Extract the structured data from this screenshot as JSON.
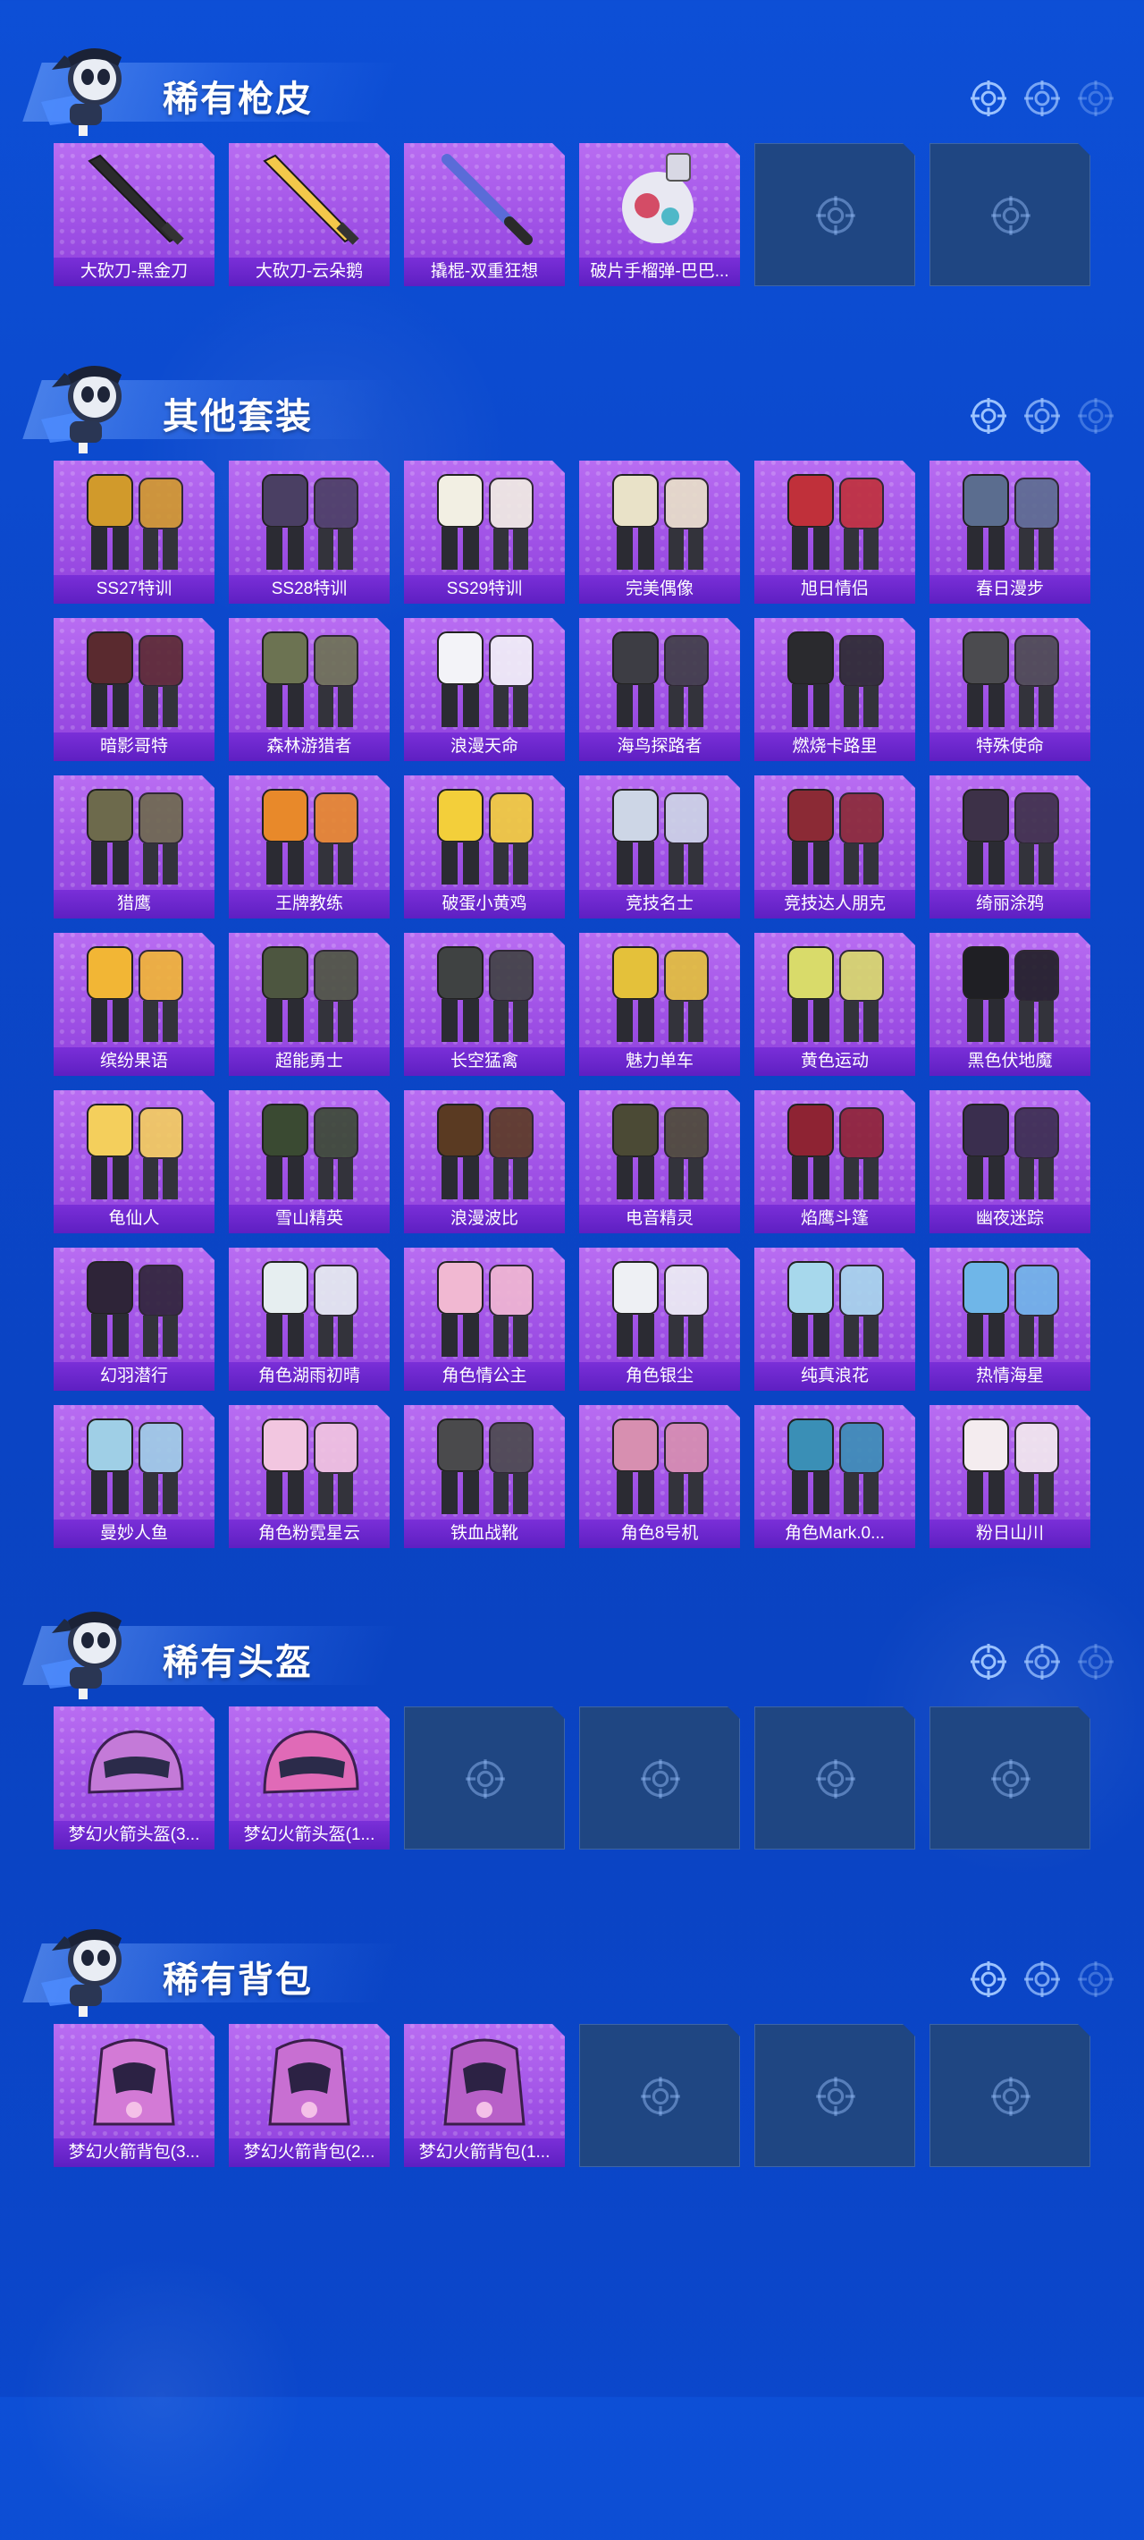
{
  "sections": [
    {
      "title": "稀有枪皮",
      "items": [
        {
          "label": "大砍刀-黑金刀",
          "icon": "blade-icon",
          "color": "#2b2b2b"
        },
        {
          "label": "大砍刀-云朵鹅",
          "icon": "blade-icon",
          "color": "#f3c84a"
        },
        {
          "label": "撬棍-双重狂想",
          "icon": "bat-icon",
          "color": "#5a6cd8"
        },
        {
          "label": "破片手榴弹-巴巴...",
          "icon": "grenade-icon",
          "color": "#e8e8f2"
        }
      ],
      "empty_slots": 2
    },
    {
      "title": "其他套装",
      "items": [
        {
          "label": "SS27特训",
          "icon": "outfit-icon",
          "color": "#d19a2b"
        },
        {
          "label": "SS28特训",
          "icon": "outfit-icon",
          "color": "#4a3f63"
        },
        {
          "label": "SS29特训",
          "icon": "outfit-icon",
          "color": "#f2efe3"
        },
        {
          "label": "完美偶像",
          "icon": "outfit-icon",
          "color": "#e9e2c8"
        },
        {
          "label": "旭日情侣",
          "icon": "outfit-icon",
          "color": "#c0303a"
        },
        {
          "label": "春日漫步",
          "icon": "outfit-icon",
          "color": "#5b6d8f"
        },
        {
          "label": "暗影哥特",
          "icon": "outfit-icon",
          "color": "#5a2a2f"
        },
        {
          "label": "森林游猎者",
          "icon": "outfit-icon",
          "color": "#6c7352"
        },
        {
          "label": "浪漫天命",
          "icon": "outfit-icon",
          "color": "#f3f3f8"
        },
        {
          "label": "海鸟探路者",
          "icon": "outfit-icon",
          "color": "#3d3d44"
        },
        {
          "label": "燃烧卡路里",
          "icon": "outfit-icon",
          "color": "#2a2a2e"
        },
        {
          "label": "特殊使命",
          "icon": "outfit-icon",
          "color": "#4b4b4f"
        },
        {
          "label": "猎鹰",
          "icon": "outfit-icon",
          "color": "#6d6a4c"
        },
        {
          "label": "王牌教练",
          "icon": "outfit-icon",
          "color": "#e8892a"
        },
        {
          "label": "破蛋小黄鸡",
          "icon": "outfit-icon",
          "color": "#f3cf3a"
        },
        {
          "label": "竞技名士",
          "icon": "outfit-icon",
          "color": "#cdd6e6"
        },
        {
          "label": "竞技达人朋克",
          "icon": "outfit-icon",
          "color": "#8b2a35"
        },
        {
          "label": "绮丽涂鸦",
          "icon": "outfit-icon",
          "color": "#3d3148"
        },
        {
          "label": "缤纷果语",
          "icon": "outfit-icon",
          "color": "#f2b635"
        },
        {
          "label": "超能勇士",
          "icon": "outfit-icon",
          "color": "#4d5640"
        },
        {
          "label": "长空猛禽",
          "icon": "outfit-icon",
          "color": "#3f4242"
        },
        {
          "label": "魅力单车",
          "icon": "outfit-icon",
          "color": "#e4c13a"
        },
        {
          "label": "黄色运动",
          "icon": "outfit-icon",
          "color": "#d9db6a"
        },
        {
          "label": "黑色伏地魔",
          "icon": "outfit-icon",
          "color": "#1f1f24"
        },
        {
          "label": "龟仙人",
          "icon": "outfit-icon",
          "color": "#f4cf5c"
        },
        {
          "label": "雪山精英",
          "icon": "outfit-icon",
          "color": "#3a4a32"
        },
        {
          "label": "浪漫波比",
          "icon": "outfit-icon",
          "color": "#5a3a22"
        },
        {
          "label": "电音精灵",
          "icon": "outfit-icon",
          "color": "#4b4a35"
        },
        {
          "label": "焰鹰斗篷",
          "icon": "outfit-icon",
          "color": "#8e2333"
        },
        {
          "label": "幽夜迷踪",
          "icon": "outfit-icon",
          "color": "#3a2e4e"
        },
        {
          "label": "幻羽潜行",
          "icon": "outfit-icon",
          "color": "#2e2438"
        },
        {
          "label": "角色湖雨初晴",
          "icon": "outfit-icon",
          "color": "#e6eef0"
        },
        {
          "label": "角色情公主",
          "icon": "outfit-icon",
          "color": "#f1b8d2"
        },
        {
          "label": "角色银尘",
          "icon": "outfit-icon",
          "color": "#eef0f4"
        },
        {
          "label": "纯真浪花",
          "icon": "outfit-icon",
          "color": "#a7d8ec"
        },
        {
          "label": "热情海星",
          "icon": "outfit-icon",
          "color": "#6fb6e8"
        },
        {
          "label": "曼妙人鱼",
          "icon": "outfit-icon",
          "color": "#9fcfe6"
        },
        {
          "label": "角色粉霓星云",
          "icon": "outfit-icon",
          "color": "#f2c6e0"
        },
        {
          "label": "铁血战靴",
          "icon": "outfit-icon",
          "color": "#4a4a4c"
        },
        {
          "label": "角色8号机",
          "icon": "outfit-icon",
          "color": "#d78fb0"
        },
        {
          "label": "角色Mark.0...",
          "icon": "outfit-icon",
          "color": "#3a8fb6"
        },
        {
          "label": "粉日山川",
          "icon": "outfit-icon",
          "color": "#f4ecef"
        }
      ],
      "empty_slots": 0
    },
    {
      "title": "稀有头盔",
      "items": [
        {
          "label": "梦幻火箭头盔(3...",
          "icon": "helmet-icon",
          "color": "#c47ad8"
        },
        {
          "label": "梦幻火箭头盔(1...",
          "icon": "helmet-icon",
          "color": "#e06ab7"
        }
      ],
      "empty_slots": 4
    },
    {
      "title": "稀有背包",
      "items": [
        {
          "label": "梦幻火箭背包(3...",
          "icon": "backpack-icon",
          "color": "#d37ad6"
        },
        {
          "label": "梦幻火箭背包(2...",
          "icon": "backpack-icon",
          "color": "#c86fd2"
        },
        {
          "label": "梦幻火箭背包(1...",
          "icon": "backpack-icon",
          "color": "#b860c8"
        }
      ],
      "empty_slots": 3
    }
  ],
  "colors": {
    "background": "#0b48cb",
    "card": "#a052e6",
    "label_bar": "#6a25cb",
    "empty_card": "#1f4682"
  }
}
